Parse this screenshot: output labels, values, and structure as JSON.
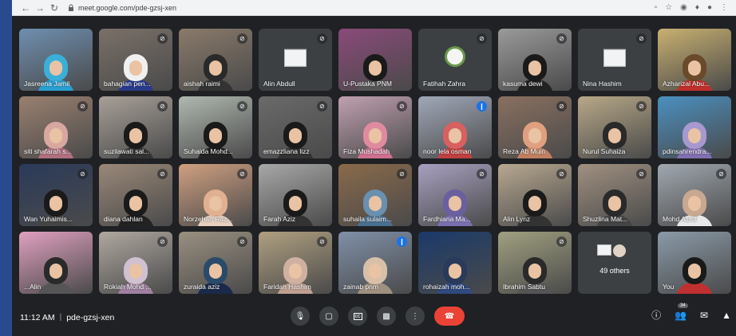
{
  "browser": {
    "url": "meet.google.com/pde-gzsj-xen"
  },
  "tiles": [
    {
      "name": "Jasreena Jamil",
      "mic": "none",
      "bg": "#6e8fb0",
      "scarf": "#3ab0d8",
      "body": "#2a9fd0"
    },
    {
      "name": "bahagian pen...",
      "mic": "muted",
      "bg": "#7a7068",
      "scarf": "#f0f0f0",
      "body": "#2a3a8a"
    },
    {
      "name": "aishah raimi",
      "mic": "muted",
      "bg": "#8a7a6a",
      "scarf": "#2a2a2a",
      "body": "#333"
    },
    {
      "name": "Alin Abdull",
      "mic": "muted",
      "type": "placeholder"
    },
    {
      "name": "U-Pustaka PNM",
      "mic": "none",
      "bg": "#8a4a7a",
      "scarf": "#1a1a1a",
      "body": "#555"
    },
    {
      "name": "Fatihah Zahra",
      "mic": "muted",
      "type": "avatar"
    },
    {
      "name": "kasuma dewi",
      "mic": "muted",
      "bg": "#9a9a9a",
      "scarf": "#1a1a1a",
      "body": "#222"
    },
    {
      "name": "Nina Hashim",
      "mic": "muted",
      "type": "placeholder"
    },
    {
      "name": "Azharizal Abu...",
      "mic": "none",
      "bg": "#c8b070",
      "scarf": "#6a4a2a",
      "body": "#c0302a"
    },
    {
      "name": "siti shafarah s...",
      "mic": "muted",
      "bg": "#9a8070",
      "scarf": "#d8a8a0",
      "body": "#b07080"
    },
    {
      "name": "suzilawati sal...",
      "mic": "muted",
      "bg": "#a8a098",
      "scarf": "#1a1a1a",
      "body": "#333"
    },
    {
      "name": "Suhaida Mohd...",
      "mic": "muted",
      "bg": "#b0b8b0",
      "scarf": "#1a1a1a",
      "body": "#222"
    },
    {
      "name": "emazzliana lizz",
      "mic": "muted",
      "bg": "#6a6a6a",
      "scarf": "#1a1a1a",
      "body": "#333"
    },
    {
      "name": "Fiza Mushadah",
      "mic": "muted",
      "bg": "#c0a0b0",
      "scarf": "#e08aa0",
      "body": "#d07090"
    },
    {
      "name": "noor lela osman",
      "mic": "speaking",
      "bg": "#a0a8b8",
      "scarf": "#d86060",
      "body": "#c04040",
      "active": true
    },
    {
      "name": "Reza Ab Muin",
      "mic": "muted",
      "bg": "#8a7060",
      "scarf": "#e0a080",
      "body": "#c08060"
    },
    {
      "name": "Nurul Suhaiza",
      "mic": "muted",
      "bg": "#b8a888",
      "scarf": "#2a2a2a",
      "body": "#555"
    },
    {
      "name": "pdinsahrendra...",
      "mic": "none",
      "bg": "#4a90c0",
      "scarf": "#a898d0",
      "body": "#8070b0"
    },
    {
      "name": "Wan Yuhaimis...",
      "mic": "muted",
      "bg": "#2a3a5a",
      "scarf": "#1a1a1a",
      "body": "#444"
    },
    {
      "name": "diana dahlan",
      "mic": "muted",
      "bg": "#9a8878",
      "scarf": "#1a1a1a",
      "body": "#222"
    },
    {
      "name": "Norzehan Raz...",
      "mic": "muted",
      "bg": "#d0a080",
      "scarf": "#e0b090",
      "body": "#e8d0c0"
    },
    {
      "name": "Farah Aziz",
      "mic": "none",
      "bg": "#a8a8a8",
      "scarf": "#1a1a1a",
      "body": "#333"
    },
    {
      "name": "suhaila sulaim...",
      "mic": "muted",
      "bg": "#8a6a4a",
      "scarf": "#6a90b0",
      "body": "#4a7090"
    },
    {
      "name": "Fardhiana Ma...",
      "mic": "muted",
      "bg": "#a8a0c0",
      "scarf": "#6a60a0",
      "body": "#7a70b0"
    },
    {
      "name": "Alin Lynz",
      "mic": "muted",
      "bg": "#b8a890",
      "scarf": "#1a1a1a",
      "body": "#333"
    },
    {
      "name": "Shuzlina Mat...",
      "mic": "muted",
      "bg": "#a09080",
      "scarf": "#2a2a2a",
      "body": "#444"
    },
    {
      "name": "Mohd Azrul",
      "mic": "muted",
      "bg": "#a0a8b0",
      "scarf": "#c8a890",
      "body": "#e8e8e8"
    },
    {
      "name": "...Alin",
      "mic": "none",
      "bg": "#e0a0c0",
      "scarf": "#2a2a2a",
      "body": "#555"
    },
    {
      "name": "Rokiah Mohd ...",
      "mic": "muted",
      "bg": "#b0a8a0",
      "scarf": "#d0c0d0",
      "body": "#a080a0"
    },
    {
      "name": "zuraida aziz",
      "mic": "muted",
      "bg": "#9a9080",
      "scarf": "#2a4a6a",
      "body": "#1a2a4a"
    },
    {
      "name": "Faridah Hashim",
      "mic": "muted",
      "bg": "#b0a080",
      "scarf": "#d0b0a0",
      "body": "#c0a090"
    },
    {
      "name": "zainab pnm",
      "mic": "speaking",
      "bg": "#8090a8",
      "scarf": "#d8c0a8",
      "body": "#a09080"
    },
    {
      "name": "rohaizah moh...",
      "mic": "none",
      "bg": "#1a3a6a",
      "scarf": "#2a3a5a",
      "body": "#304a80"
    },
    {
      "name": "Ibrahim Sabtu",
      "mic": "muted",
      "bg": "#a0a080",
      "scarf": "#2a2a2a",
      "body": "#555"
    },
    {
      "name": "49 others",
      "type": "others"
    },
    {
      "name": "You",
      "mic": "none",
      "bg": "#8a9aa8",
      "scarf": "#1a1a1a",
      "body": "#c03030"
    }
  ],
  "bottom": {
    "time": "11:12 AM",
    "separator": "|",
    "meeting_code": "pde-gzsj-xen",
    "people_count": "34"
  }
}
